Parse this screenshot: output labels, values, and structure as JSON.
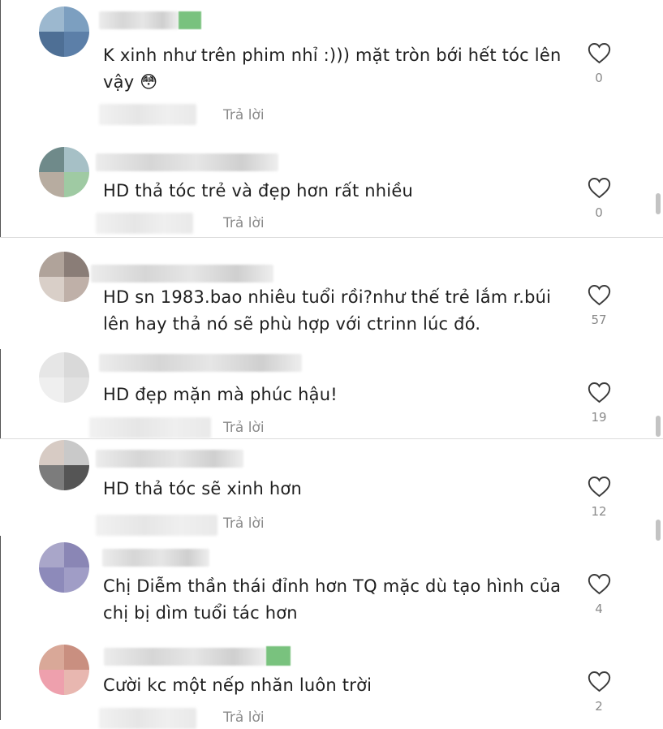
{
  "comments": [
    {
      "text": "K xinh như trên phim nhỉ :))) mặt tròn bới hết tóc lên vậy 😳",
      "likes": "0",
      "reply_label": "Trả lời"
    },
    {
      "text": "HD thả tóc trẻ và đẹp hơn rất nhiều",
      "likes": "0",
      "reply_label": "Trả lời"
    },
    {
      "text": "HD sn 1983.bao nhiêu tuổi rồi?như thế trẻ lắm r.búi lên hay thả nó sẽ phù hợp với ctrinn lúc đó.",
      "likes": "57"
    },
    {
      "text": "HD đẹp mặn mà phúc hậu!",
      "likes": "19",
      "reply_label": "Trả lời"
    },
    {
      "text": "HD thả tóc sẽ xinh hơn",
      "likes": "12",
      "reply_label": "Trả lời"
    },
    {
      "text": "Chị Diễm thần thái đỉnh hơn TQ mặc dù tạo hình của chị bị dìm tuổi tác hơn",
      "likes": "4"
    },
    {
      "text": "Cười kc một nếp nhăn luôn trời",
      "likes": "2",
      "reply_label": "Trả lời"
    }
  ],
  "icons": {
    "like": "heart-outline-icon"
  },
  "colors": {
    "text": "#1e1e1e",
    "secondary": "#8a8a8a",
    "badge": "#79c27e"
  }
}
